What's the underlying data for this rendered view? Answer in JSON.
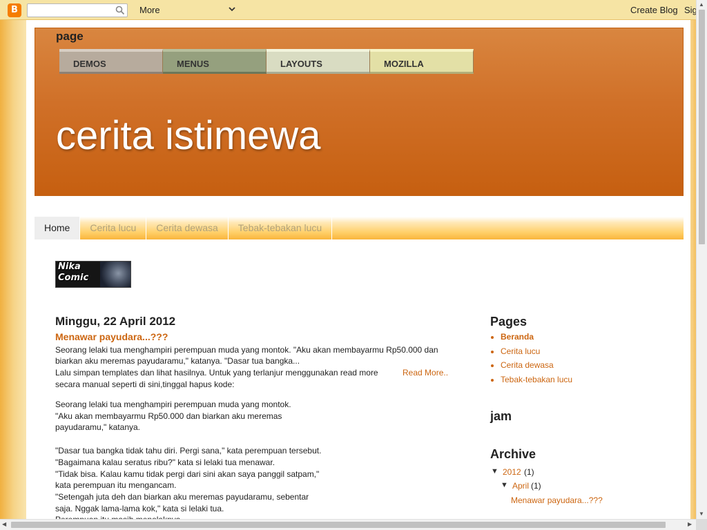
{
  "navbar": {
    "logo_glyph": "B",
    "search_placeholder": "",
    "more_label": "More",
    "create_blog": "Create Blog",
    "sign_in": "Sign In"
  },
  "header": {
    "page_label": "page",
    "top_menu": [
      "DEMOS",
      "MENUS",
      "LAYOUTS",
      "MOZILLA"
    ],
    "blog_title": "cerita istimewa"
  },
  "tabs": [
    "Home",
    "Cerita lucu",
    "Cerita dewasa",
    "Tebak-tebakan lucu"
  ],
  "logo_image": {
    "text_line1": "Nika",
    "text_line2": "Comic"
  },
  "post": {
    "date": "Minggu, 22 April 2012",
    "title": "Menawar payudara...???",
    "summary": [
      "Seorang lelaki tua menghampiri perempuan muda yang montok. \"Aku akan membayarmu Rp50.000 dan",
      "biarkan aku meremas payudaramu,\" katanya. \"Dasar tua bangka...",
      "Lalu simpan templates dan lihat hasilnya. Untuk yang terlanjur menggunakan read more",
      "secara manual seperti di sini,tinggal hapus kode:"
    ],
    "read_more": "Read More..",
    "body": [
      "Seorang lelaki tua menghampiri perempuan muda yang montok.",
      "\"Aku akan membayarmu Rp50.000 dan biarkan aku meremas",
      "payudaramu,\" katanya.",
      "\"Dasar tua bangka tidak tahu diri. Pergi sana,\" kata perempuan tersebut.",
      "\"Bagaimana kalau seratus ribu?\" kata si lelaki tua menawar.",
      "\"Tidak bisa. Kalau kamu tidak pergi dari sini akan saya panggil satpam,\"",
      "kata perempuan itu mengancam.",
      "\"Setengah juta deh dan biarkan aku meremas payudaramu, sebentar",
      "saja. Nggak lama-lama kok,\" kata si lelaki tua.",
      "Perempuan itu masih menolaknya."
    ]
  },
  "sidebar": {
    "pages_heading": "Pages",
    "pages": [
      "Beranda",
      "Cerita lucu",
      "Cerita dewasa",
      "Tebak-tebakan lucu"
    ],
    "jam_heading": "jam",
    "archive_heading": "Archive",
    "archive": {
      "toggle": "▼",
      "year": "2012",
      "year_count": "(1)",
      "month": "April",
      "month_count": "(1)",
      "post": "Menawar payudara...???"
    }
  },
  "colors": {
    "link": "#cc6611",
    "header_top": "#d98640",
    "header_bottom": "#c65f10",
    "tabs_bar": "#ffcf68"
  }
}
